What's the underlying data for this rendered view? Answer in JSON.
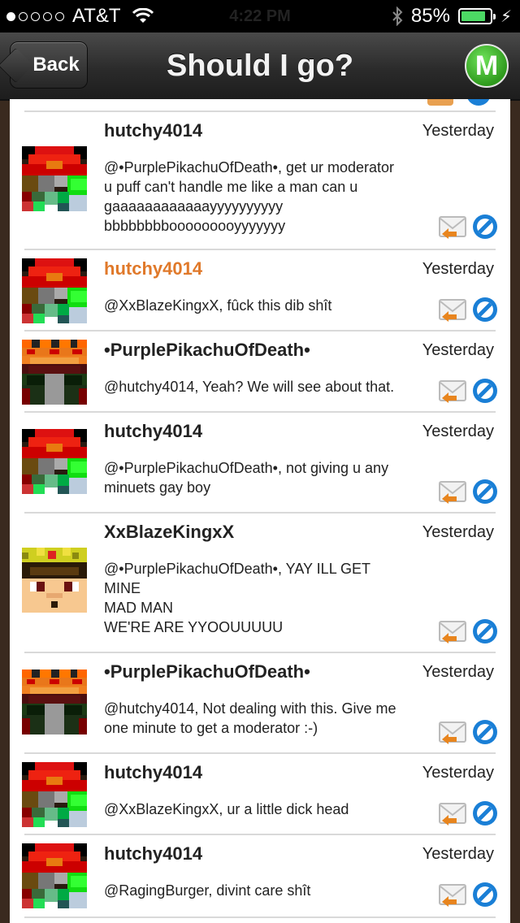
{
  "status": {
    "carrier": "AT&T",
    "time": "4:22 PM",
    "battery": "85%"
  },
  "nav": {
    "back": "Back",
    "title": "Should I go?",
    "logo": "M"
  },
  "messages": [
    {
      "user": "hutchy4014",
      "time": "Yesterday",
      "avatar": "hutchy-avatar",
      "text": "@•PurplePikachuOfDeath•, get ur moderator\nu puff can't handle me like a man can u\ngaaaaaaaaaaaayyyyyyyyyy\nbbbbbbbbooooooooyyyyyyy"
    },
    {
      "user": "hutchy4014",
      "time": "Yesterday",
      "avatar": "hutchy-avatar",
      "highlight": true,
      "text": "@XxBlazeKingxX, fûck this dib shît"
    },
    {
      "user": "•PurplePikachuOfDeath•",
      "time": "Yesterday",
      "avatar": "purple-avatar",
      "text": "@hutchy4014, Yeah? We will see about that."
    },
    {
      "user": "hutchy4014",
      "time": "Yesterday",
      "avatar": "hutchy-avatar",
      "text": "@•PurplePikachuOfDeath•, not giving u any\nminuets gay boy"
    },
    {
      "user": "XxBlazeKingxX",
      "time": "Yesterday",
      "avatar": "blaze-avatar",
      "text": "@•PurplePikachuOfDeath•, YAY ILL GET\nMINE\nMAD MAN\nWE'RE ARE YYOOUUUUU"
    },
    {
      "user": "•PurplePikachuOfDeath•",
      "time": "Yesterday",
      "avatar": "purple-avatar",
      "text": "@hutchy4014, Not dealing with this. Give me\none minute to get a moderator :-)"
    },
    {
      "user": "hutchy4014",
      "time": "Yesterday",
      "avatar": "hutchy-avatar",
      "text": "@XxBlazeKingxX, ur a little dick head"
    },
    {
      "user": "hutchy4014",
      "time": "Yesterday",
      "avatar": "hutchy-avatar",
      "text": "@RagingBurger, divint care shît"
    }
  ],
  "colors": {
    "accent": "#e0792a",
    "block": "#1a7fd6",
    "nav": "#2b2b2b"
  },
  "icons": {
    "reply": "reply-icon",
    "block": "block-icon"
  }
}
